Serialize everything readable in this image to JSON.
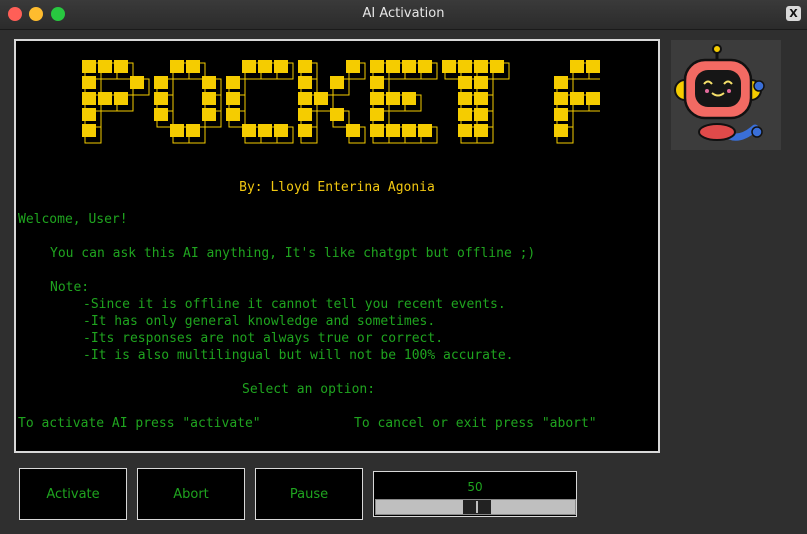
{
  "window": {
    "title": "AI Activation",
    "close_symbol": "X"
  },
  "terminal": {
    "logo_text": "POCKET AI",
    "byline": "By: Lloyd Enterina Agonia",
    "welcome": "Welcome, User!",
    "intro": "You can ask this AI anything, It's like chatgpt but offline ;)",
    "note_heading": "Note:",
    "notes": [
      "-Since it is offline it cannot tell you recent events.",
      "-It has only general knowledge and sometimes.",
      "-Its responses are not always true or correct.",
      "-It is also multilingual but will not be 100% accurate."
    ],
    "select_prompt": "Select an option:",
    "activate_hint": "To activate AI press \"activate\"",
    "abort_hint": "To cancel or exit press \"abort\""
  },
  "buttons": {
    "activate": "Activate",
    "abort": "Abort",
    "pause": "Pause"
  },
  "slider": {
    "value": 50,
    "value_label": "50",
    "min": 0,
    "max": 100
  },
  "avatar": {
    "icon": "robot-mascot-icon"
  },
  "colors": {
    "terminal_text": "#1fa41f",
    "logo": "#f5cc00",
    "byline": "#f2c811"
  }
}
